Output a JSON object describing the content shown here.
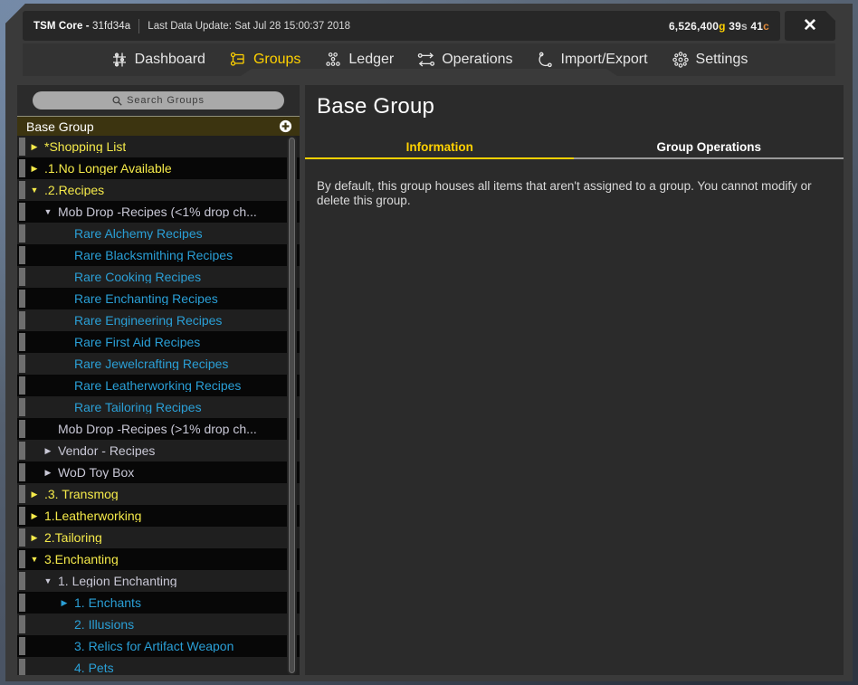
{
  "titlebar": {
    "app_name": "TSM Core",
    "version_sep": " - ",
    "version": "31fd34a",
    "update_label": "Last Data Update: Sat Jul 28 15:00:37 2018",
    "money": {
      "gold": "6,526,400",
      "gold_suffix": "g",
      "silver": "39",
      "silver_suffix": "s",
      "copper": "41",
      "copper_suffix": "c"
    },
    "close_glyph": "✕"
  },
  "nav": {
    "items": [
      {
        "label": "Dashboard",
        "icon": "dashboard-icon",
        "active": false
      },
      {
        "label": "Groups",
        "icon": "groups-icon",
        "active": true
      },
      {
        "label": "Ledger",
        "icon": "ledger-icon",
        "active": false
      },
      {
        "label": "Operations",
        "icon": "operations-icon",
        "active": false
      },
      {
        "label": "Import/Export",
        "icon": "import-export-icon",
        "active": false
      },
      {
        "label": "Settings",
        "icon": "settings-icon",
        "active": false
      }
    ]
  },
  "sidebar": {
    "search_placeholder": "Search Groups",
    "tree_header": {
      "label": "Base Group",
      "add_icon": "plus-circle-icon"
    },
    "tree": [
      {
        "label": "*Shopping List",
        "level": 1,
        "state": "collapsed"
      },
      {
        "label": ".1.No Longer Available",
        "level": 1,
        "state": "collapsed"
      },
      {
        "label": ".2.Recipes",
        "level": 1,
        "state": "expanded"
      },
      {
        "label": "Mob Drop -Recipes (<1% drop ch...",
        "level": 2,
        "state": "expanded"
      },
      {
        "label": "Rare Alchemy Recipes",
        "level": 3,
        "state": "leaf"
      },
      {
        "label": "Rare Blacksmithing Recipes",
        "level": 3,
        "state": "leaf"
      },
      {
        "label": "Rare Cooking Recipes",
        "level": 3,
        "state": "leaf"
      },
      {
        "label": "Rare Enchanting Recipes",
        "level": 3,
        "state": "leaf"
      },
      {
        "label": "Rare Engineering Recipes",
        "level": 3,
        "state": "leaf"
      },
      {
        "label": "Rare First Aid Recipes",
        "level": 3,
        "state": "leaf"
      },
      {
        "label": "Rare Jewelcrafting Recipes",
        "level": 3,
        "state": "leaf"
      },
      {
        "label": "Rare Leatherworking Recipes",
        "level": 3,
        "state": "leaf"
      },
      {
        "label": "Rare Tailoring Recipes",
        "level": 3,
        "state": "leaf"
      },
      {
        "label": "Mob Drop -Recipes (>1% drop ch...",
        "level": 2,
        "state": "leaf"
      },
      {
        "label": "Vendor - Recipes",
        "level": 2,
        "state": "collapsed"
      },
      {
        "label": "WoD Toy Box",
        "level": 2,
        "state": "collapsed"
      },
      {
        "label": ".3. Transmog",
        "level": 1,
        "state": "collapsed"
      },
      {
        "label": "1.Leatherworking",
        "level": 1,
        "state": "collapsed"
      },
      {
        "label": "2.Tailoring",
        "level": 1,
        "state": "collapsed"
      },
      {
        "label": "3.Enchanting",
        "level": 1,
        "state": "expanded"
      },
      {
        "label": "1. Legion Enchanting",
        "level": 2,
        "state": "expanded"
      },
      {
        "label": "1. Enchants",
        "level": 3,
        "state": "collapsed"
      },
      {
        "label": "2. Illusions",
        "level": 3,
        "state": "leaf"
      },
      {
        "label": "3. Relics for Artifact Weapon",
        "level": 3,
        "state": "leaf"
      },
      {
        "label": "4. Pets",
        "level": 3,
        "state": "leaf"
      }
    ],
    "arrow_collapsed": "▶",
    "arrow_expanded": "▼"
  },
  "main": {
    "title": "Base Group",
    "tabs": [
      {
        "label": "Information",
        "active": true
      },
      {
        "label": "Group Operations",
        "active": false
      }
    ],
    "body_text": "By default, this group houses all items that aren't assigned to a group. You cannot modify or delete this group."
  },
  "colors": {
    "accent": "#ffd100",
    "level1_text": "#f5ea4a",
    "level2_text": "#c9c8d6",
    "level3_text": "#2a9fd6",
    "window_bg": "#3a3a3a",
    "panel_bg": "#2b2b2b",
    "tree_bg": "#1a1a1a",
    "header_bg": "#3c3410"
  }
}
